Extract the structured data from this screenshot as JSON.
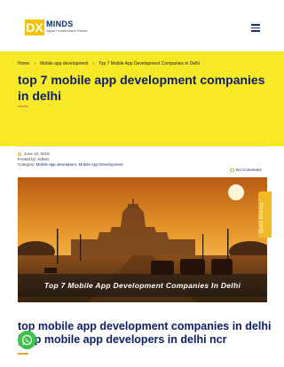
{
  "header": {
    "logo_mark": "DX",
    "logo_name": "MINDS",
    "logo_tagline": "Digital Transformation Partner",
    "menu_icon": "hamburger-menu-icon"
  },
  "breadcrumb": [
    "Home",
    "Mobile app development",
    "Top 7 Mobile App Development Companies in Delhi"
  ],
  "page_title": "top 7 mobile app development companies in delhi",
  "post_meta": {
    "date": "June 10, 2019",
    "posted_by_label": "Posted by:",
    "author": "Admin",
    "category_label": "Category:",
    "categories": "Mobile app developers, Mobile App Development",
    "comments": "No Comments"
  },
  "featured_image": {
    "caption": "Top 7 Mobile App Development Companies In Delhi"
  },
  "quick_enquiry": "Quick Enquiry",
  "section_heading": "top  mobile app development companies in delhi | top mobile app developers in delhi ncr",
  "colors": {
    "accent_yellow": "#f7e928",
    "navy": "#0c1f63",
    "gold": "#e0a93a",
    "whatsapp_green": "#3fbf4b"
  },
  "icons": [
    "hamburger-menu-icon",
    "clock-icon",
    "comment-icon",
    "whatsapp-icon"
  ]
}
